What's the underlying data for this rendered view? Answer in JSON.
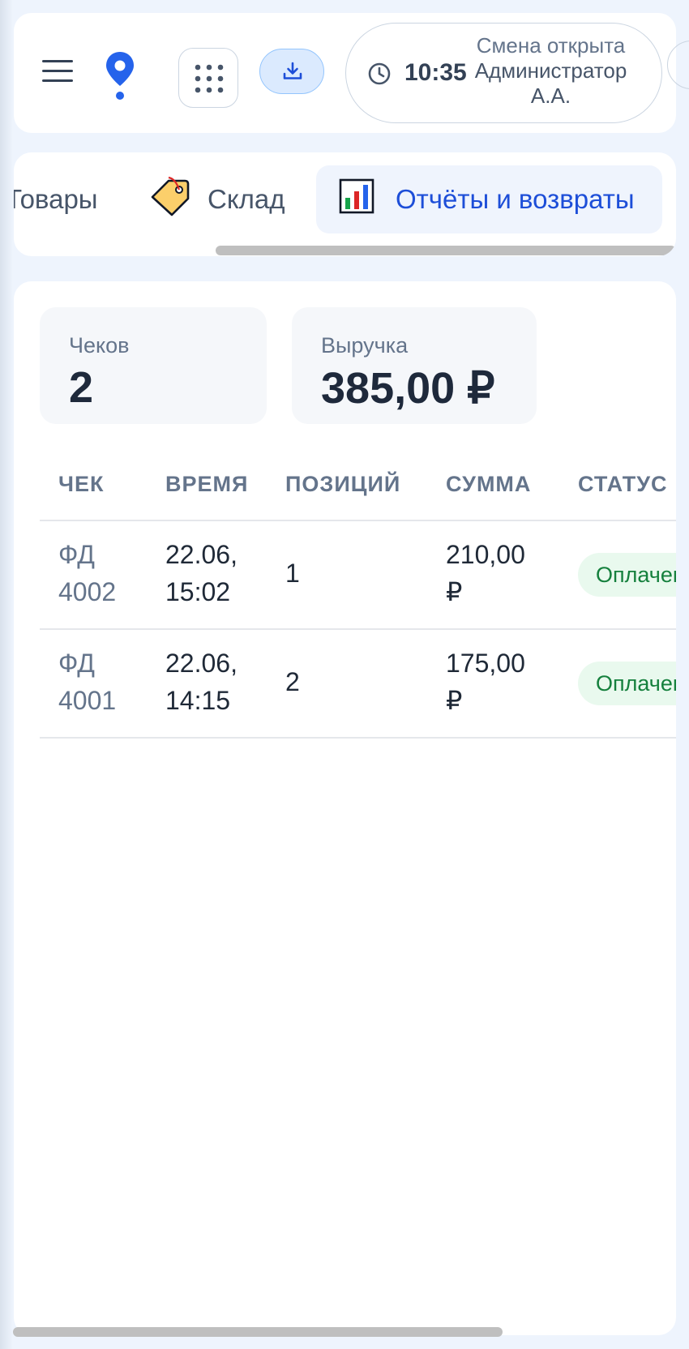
{
  "header": {
    "time": "10:35",
    "shift_status": "Смена открыта",
    "user_name": "Администратор А.А.",
    "icons": [
      "menu-icon",
      "location-pin-icon",
      "apps-grid-icon",
      "download-icon",
      "clock-icon"
    ],
    "accent_color": "#2563eb"
  },
  "tabs": [
    {
      "label": "Товары",
      "icon": null,
      "active": false
    },
    {
      "label": "Склад",
      "icon": "price-tag-icon",
      "active": false
    },
    {
      "label": "Отчёты и возвраты",
      "icon": "bar-chart-icon",
      "active": true
    }
  ],
  "stats": {
    "receipts_label": "Чеков",
    "receipts_value": "2",
    "revenue_label": "Выручка",
    "revenue_value": "385,00 ₽"
  },
  "table": {
    "columns": [
      "ЧЕК",
      "ВРЕМЯ",
      "ПОЗИЦИЙ",
      "СУММА",
      "СТАТУС"
    ],
    "rows": [
      {
        "fd_line1": "ФД",
        "fd_line2": "4002",
        "date": "22.06,",
        "time": "15:02",
        "items": "1",
        "amount": "210,00",
        "currency": "₽",
        "status": "Оплачен"
      },
      {
        "fd_line1": "ФД",
        "fd_line2": "4001",
        "date": "22.06,",
        "time": "14:15",
        "items": "2",
        "amount": "175,00",
        "currency": "₽",
        "status": "Оплачен"
      }
    ],
    "status_color": "#15803d"
  }
}
